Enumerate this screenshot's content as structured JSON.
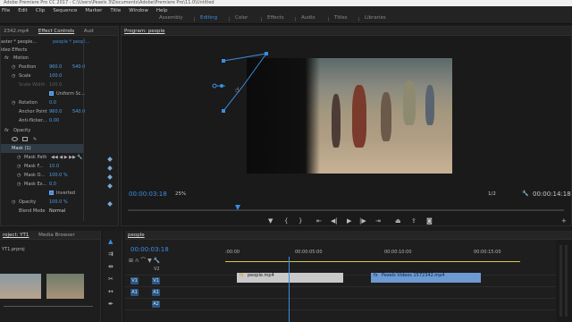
{
  "window": {
    "title": "Adobe Premiere Pro CC 2017 - C:\\Users\\Pexels 3\\Documents\\Adobe\\Premiere Pro\\11.0\\Untitled"
  },
  "menu": [
    "File",
    "Edit",
    "Clip",
    "Sequence",
    "Marker",
    "Title",
    "Window",
    "Help"
  ],
  "workspaces": [
    {
      "label": "Assembly",
      "active": false
    },
    {
      "label": "Editing",
      "active": true
    },
    {
      "label": "Color",
      "active": false
    },
    {
      "label": "Effects",
      "active": false
    },
    {
      "label": "Audio",
      "active": false
    },
    {
      "label": "Titles",
      "active": false
    },
    {
      "label": "Libraries",
      "active": false
    }
  ],
  "left_tabs": {
    "source": "2342.mp4",
    "effect_controls": "Effect Controls",
    "audio": "Aud"
  },
  "effect_controls": {
    "master": "aster * people...",
    "seq": "people * peopl...",
    "section": "ideo Effects",
    "motion": "Motion",
    "position": {
      "label": "Position",
      "x": "960.0",
      "y": "540.0"
    },
    "scale": {
      "label": "Scale",
      "value": "100.0"
    },
    "scale_width": {
      "label": "Scale Width",
      "value": "100.0"
    },
    "uniform": "Uniform Sc...",
    "rotation": {
      "label": "Rotation",
      "value": "0.0"
    },
    "anchor": {
      "label": "Anchor Point",
      "x": "960.0",
      "y": "540.0"
    },
    "antiflicker": {
      "label": "Anti-flicker...",
      "value": "0.00"
    },
    "opacity_section": "Opacity",
    "mask": "Mask (1)",
    "mask_path": "Mask Path",
    "mask_feather": {
      "label": "Mask F...",
      "value": "10.0"
    },
    "mask_opacity": {
      "label": "Mask O...",
      "value": "100.0 %"
    },
    "mask_expansion": {
      "label": "Mask Ex...",
      "value": "0.0"
    },
    "inverted": "Inverted",
    "opacity": {
      "label": "Opacity",
      "value": "100.0 %"
    },
    "blend_mode": {
      "label": "Blend Mode",
      "value": "Normal"
    }
  },
  "program": {
    "tab": "Program: people",
    "timecode_left": "00:00:03:18",
    "zoom": "25%",
    "resolution": "1/2",
    "timecode_right": "00:00:14:18"
  },
  "project": {
    "tab": "roject: YT1",
    "media_browser": "Media Browser",
    "file": "YT1.prproj"
  },
  "timeline": {
    "tab": "people",
    "timecode": "00:00:03:18",
    "ruler": [
      ":00:00",
      "00:00:05:00",
      "00:00:10:00",
      "00:00:15:00"
    ],
    "tracks": [
      "V2",
      "V1",
      "A1",
      "A2"
    ],
    "clips": [
      {
        "name": "people.mp4",
        "badge": "fx"
      },
      {
        "name": "Pexels Videos 1572342.mp4",
        "badge": "fx"
      }
    ]
  },
  "colors": {
    "accent": "#3b8de0",
    "clip_a": "#c9c9c9",
    "clip_b": "#6e9ad3",
    "playhead": "#3b8de0"
  }
}
